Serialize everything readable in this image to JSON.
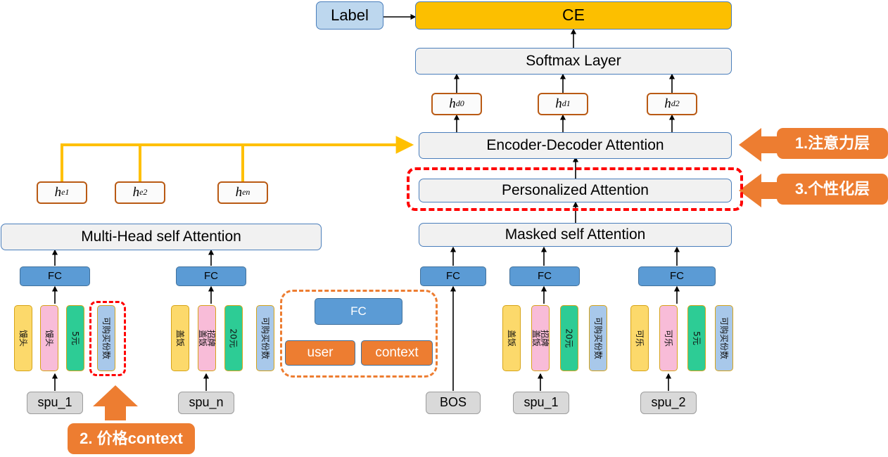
{
  "colors": {
    "accent_orange": "#ed7d31",
    "bar_yellow": "#fcbf00",
    "light_bar": "#f1f1f1",
    "bar_border_blue": "#4a7ebb",
    "label_blue": "#bdd7ee",
    "fc_blue": "#5b9bd5",
    "highlight_red": "#ff0000",
    "connector_yellow": "#ffc000",
    "token_yellow": "#fcd96b",
    "token_pink": "#f8bcd8",
    "token_green": "#2dcc95",
    "token_blue": "#a8c8ea",
    "spu_gray": "#d9d9d9"
  },
  "top": {
    "label_box": "Label",
    "loss_bar": "CE",
    "softmax_bar": "Softmax Layer"
  },
  "decoder": {
    "hidden_states": [
      "h",
      "h",
      "h"
    ],
    "hidden_subs": [
      "d0",
      "d1",
      "d2"
    ],
    "encoder_decoder_attention": "Encoder-Decoder Attention",
    "personalized_attention": "Personalized Attention",
    "masked_self_attention": "Masked self Attention",
    "fc_labels": [
      "FC",
      "FC",
      "FC"
    ],
    "spu_labels": [
      "BOS",
      "spu_1",
      "spu_2"
    ],
    "token_groups": [
      {
        "name": "group-spu1",
        "tokens": [
          {
            "text": "盖饭",
            "color": "token_yellow"
          },
          {
            "text": "招牌盖饭",
            "color": "token_pink"
          },
          {
            "text": "20元",
            "color": "token_green"
          },
          {
            "text": "可购买份数",
            "color": "token_blue"
          }
        ]
      },
      {
        "name": "group-spu2",
        "tokens": [
          {
            "text": "可乐",
            "color": "token_yellow"
          },
          {
            "text": "可乐",
            "color": "token_pink"
          },
          {
            "text": "5元",
            "color": "token_green"
          },
          {
            "text": "可购买份数",
            "color": "token_blue"
          }
        ]
      }
    ]
  },
  "encoder": {
    "hidden_states": [
      "h",
      "h",
      "h"
    ],
    "hidden_subs": [
      "e1",
      "e2",
      "en"
    ],
    "multi_head_self_attention": "Multi-Head self Attention",
    "fc_labels": [
      "FC",
      "FC"
    ],
    "spu_labels": [
      "spu_1",
      "spu_n"
    ],
    "token_groups": [
      {
        "name": "group-spu1",
        "tokens": [
          {
            "text": "馒头",
            "color": "token_yellow"
          },
          {
            "text": "馒头",
            "color": "token_pink"
          },
          {
            "text": "5元",
            "color": "token_green"
          },
          {
            "text": "可购买份数",
            "color": "token_blue"
          }
        ]
      },
      {
        "name": "group-spun",
        "tokens": [
          {
            "text": "盖饭",
            "color": "token_yellow"
          },
          {
            "text": "招牌盖饭",
            "color": "token_pink"
          },
          {
            "text": "20元",
            "color": "token_green"
          },
          {
            "text": "可购买份数",
            "color": "token_blue"
          }
        ]
      }
    ]
  },
  "popup": {
    "fc": "FC",
    "user": "user",
    "context": "context"
  },
  "annotations": {
    "attention_layer": "1.注意力层",
    "personalization_layer": "3.个性化层",
    "price_context": "2. 价格context"
  }
}
